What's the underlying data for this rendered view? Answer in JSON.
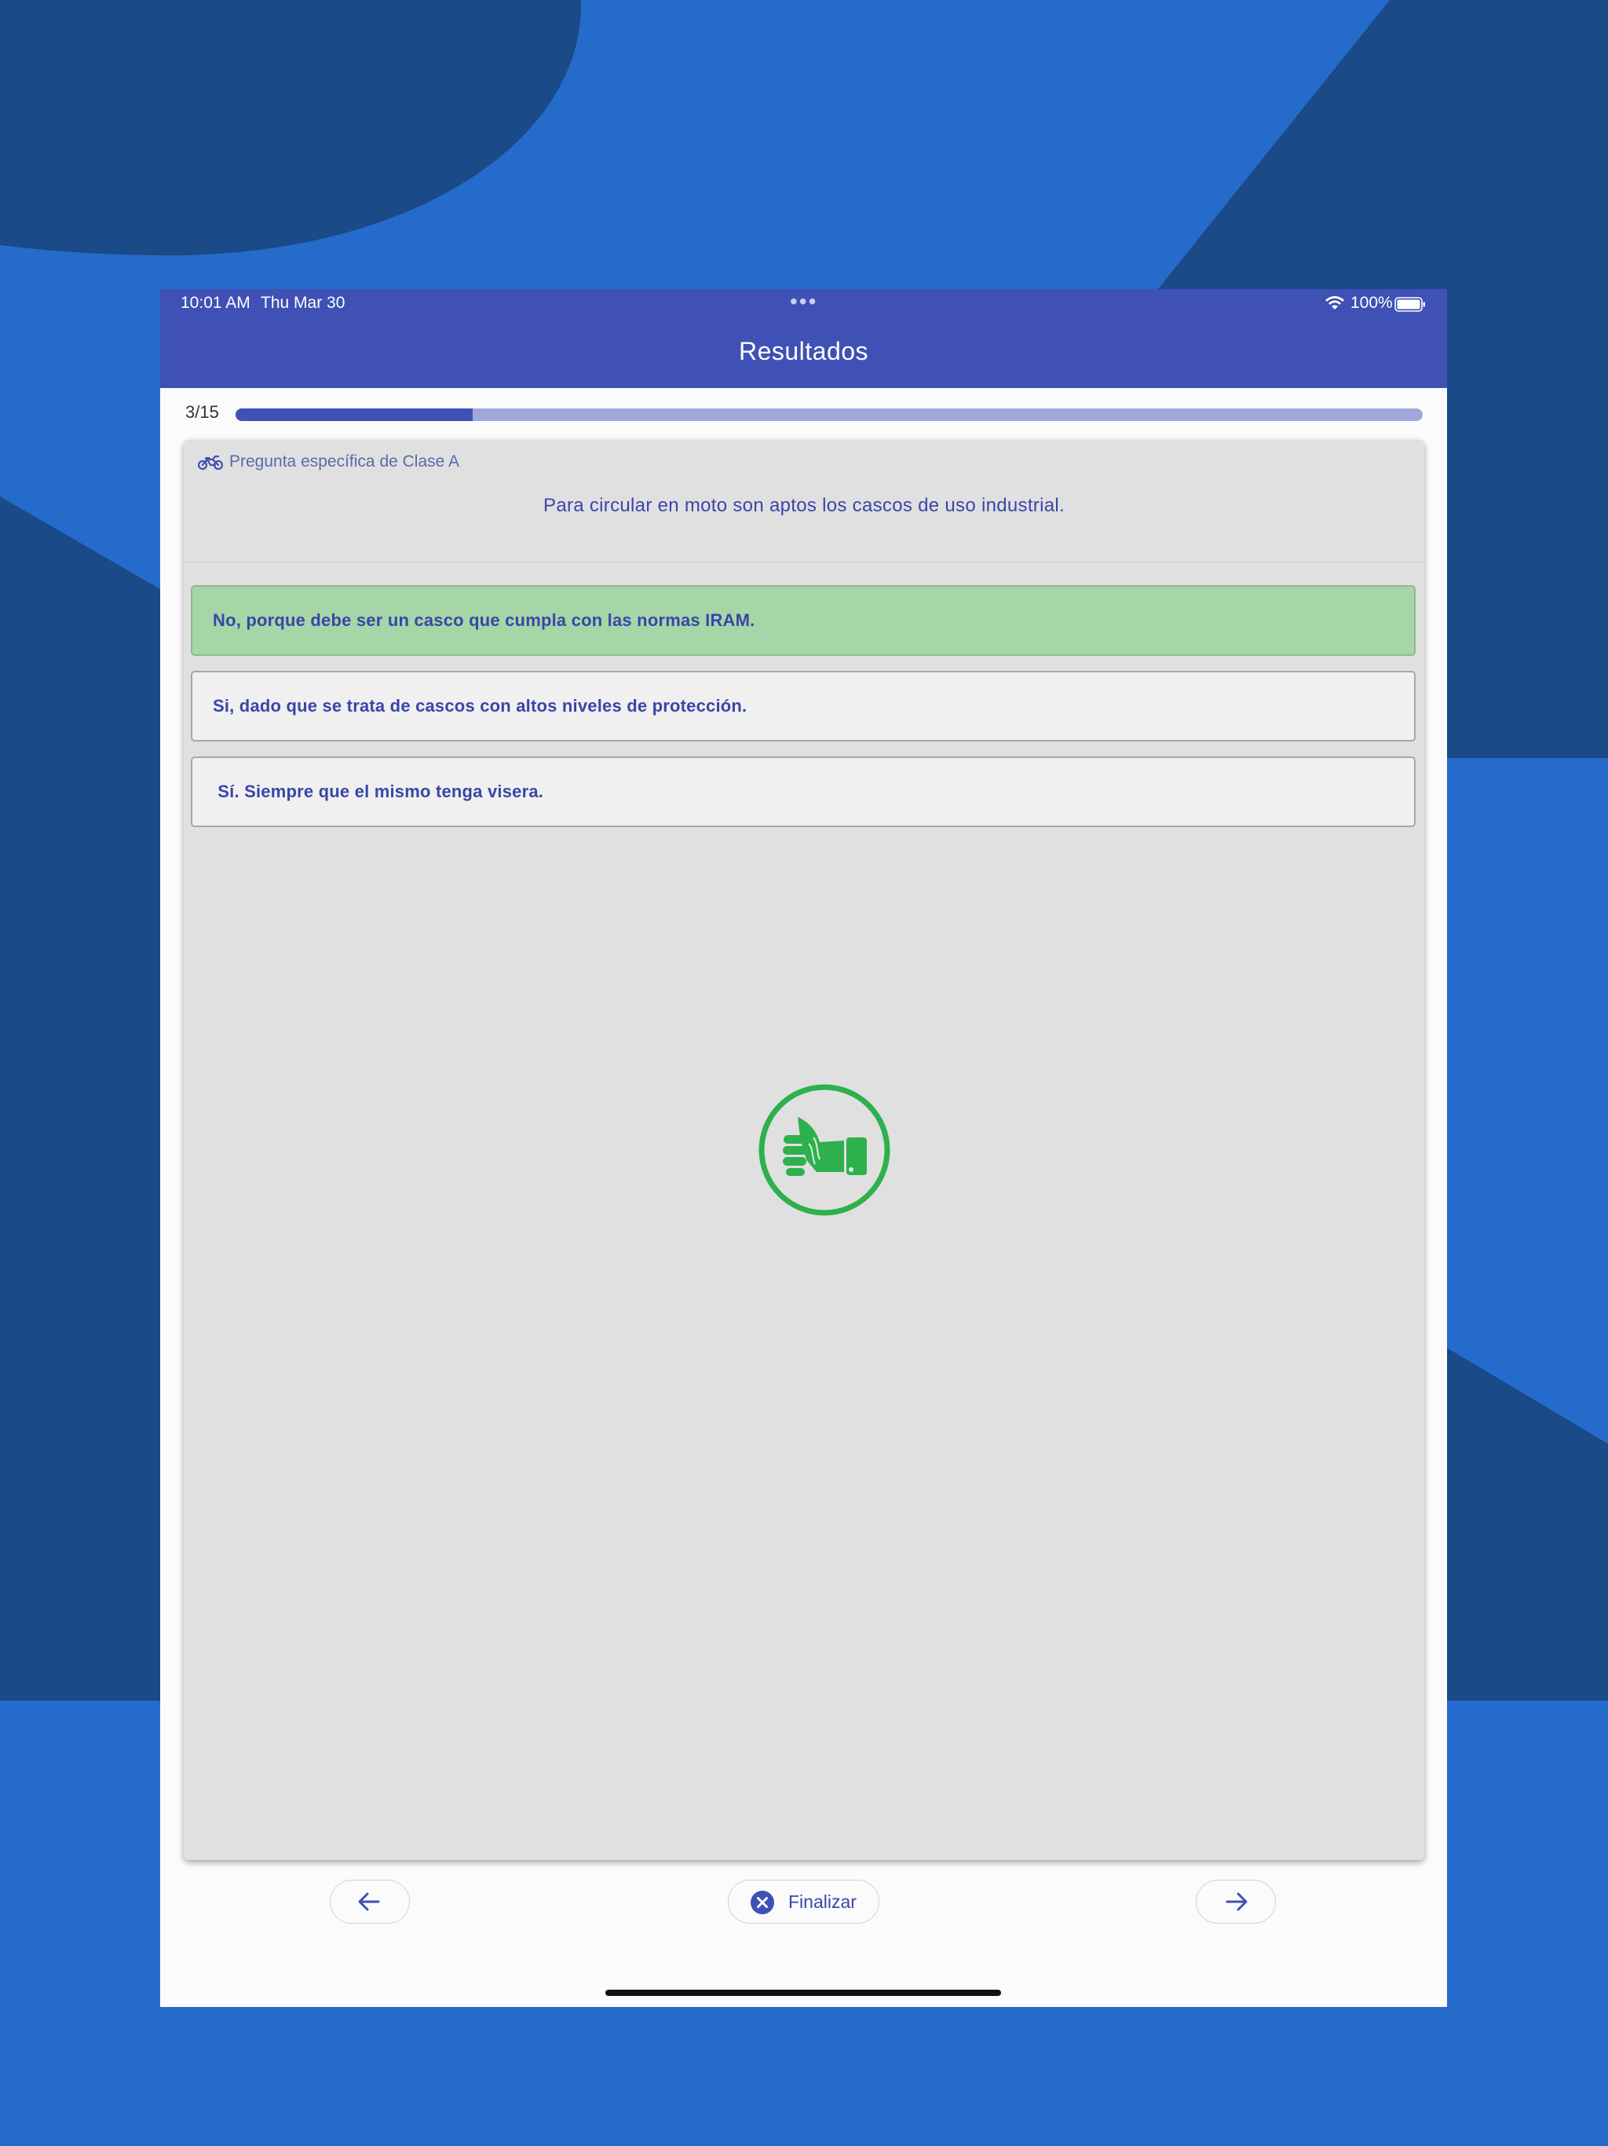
{
  "status_bar": {
    "time": "10:01 AM",
    "date": "Thu Mar 30",
    "dots": "•••",
    "battery": "100%"
  },
  "header": {
    "title": "Resultados"
  },
  "progress": {
    "label": "3/15",
    "current": 3,
    "total": 15,
    "fraction": 0.2
  },
  "question": {
    "category_icon": "motorcycle-icon",
    "category": "Pregunta específica de Clase A",
    "text": "Para circular en moto son aptos los cascos de uso industrial.",
    "answers": [
      {
        "text": "No, porque debe ser un casco que cumpla con las normas IRAM.",
        "correct": true
      },
      {
        "text": "Si, dado que se trata de cascos con altos niveles de protección.",
        "correct": false
      },
      {
        "text": " Sí. Siempre que el mismo tenga visera.",
        "correct": false
      }
    ]
  },
  "result": {
    "icon": "thumbs-up-icon",
    "color": "#2eb04d"
  },
  "nav": {
    "prev_icon": "arrow-left-icon",
    "finish_icon": "close-circle-icon",
    "finish_label": "Finalizar",
    "next_icon": "arrow-right-icon"
  },
  "colors": {
    "primary": "#3f51b5",
    "progress_track": "#9fa8da",
    "correct_answer_bg": "#a5d6a7",
    "answer_text": "#3946a8",
    "wallpaper_light": "#256bcc",
    "wallpaper_dark": "#1a4a87"
  }
}
